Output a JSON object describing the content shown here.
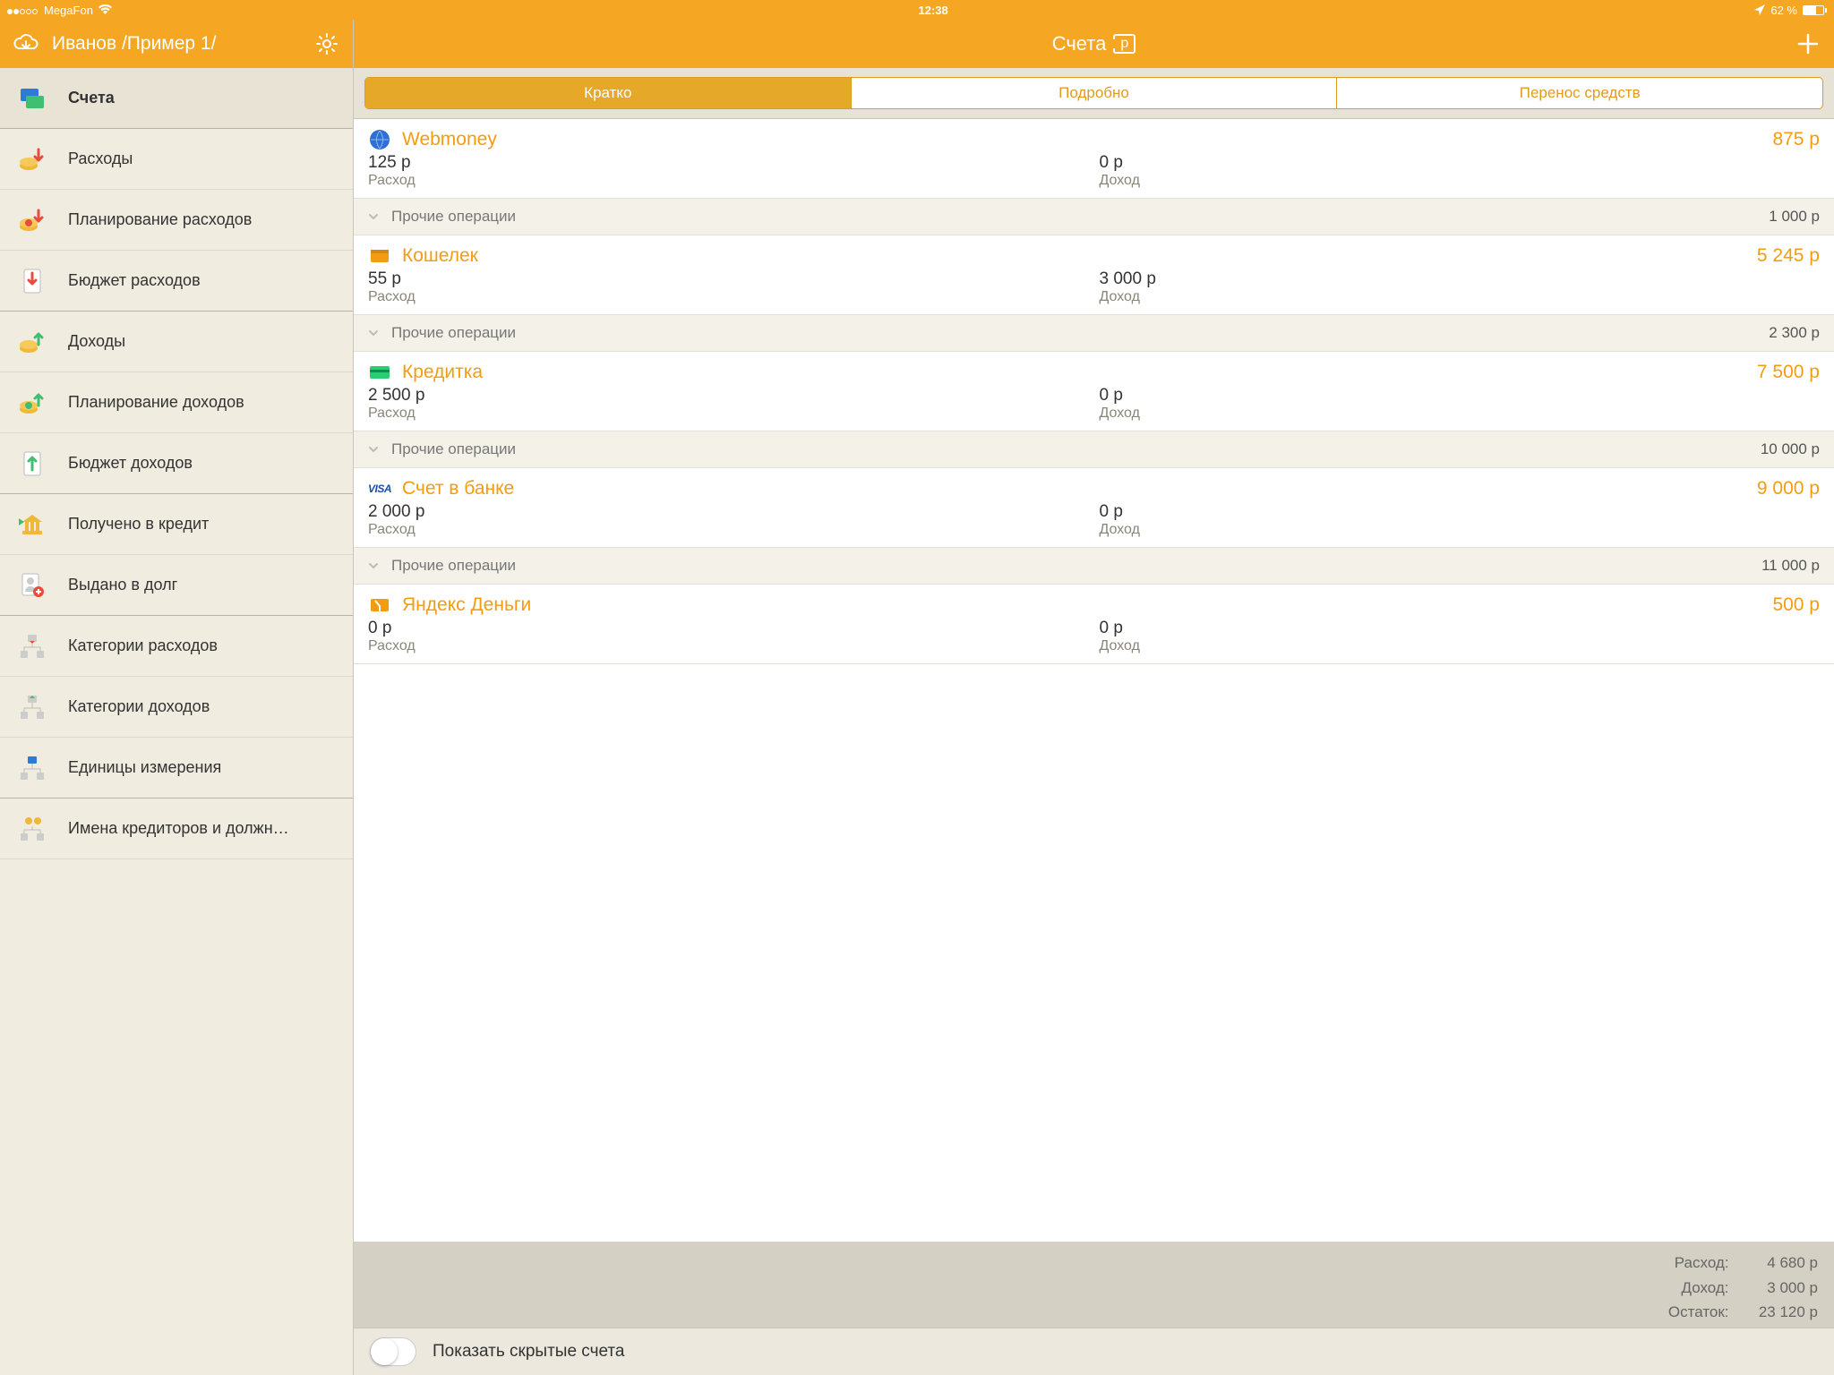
{
  "status": {
    "carrier": "MegaFon",
    "time": "12:38",
    "battery_pct": "62 %"
  },
  "sidebar": {
    "title": "Иванов /Пример 1/",
    "items": [
      {
        "label": "Счета",
        "icon": "wallet-cards-icon",
        "active": true
      },
      {
        "label": "Расходы",
        "icon": "coins-down-icon"
      },
      {
        "label": "Планирование расходов",
        "icon": "coins-down-plan-icon"
      },
      {
        "label": "Бюджет расходов",
        "icon": "doc-down-icon"
      },
      {
        "label": "Доходы",
        "icon": "coins-up-icon"
      },
      {
        "label": "Планирование доходов",
        "icon": "coins-up-plan-icon"
      },
      {
        "label": "Бюджет доходов",
        "icon": "doc-up-icon"
      },
      {
        "label": "Получено в кредит",
        "icon": "bank-in-icon"
      },
      {
        "label": "Выдано в долг",
        "icon": "person-debt-icon"
      },
      {
        "label": "Категории расходов",
        "icon": "tree-down-icon"
      },
      {
        "label": "Категории доходов",
        "icon": "tree-up-icon"
      },
      {
        "label": "Единицы измерения",
        "icon": "ruler-tree-icon"
      },
      {
        "label": "Имена кредиторов и должн…",
        "icon": "people-tree-icon"
      }
    ]
  },
  "main": {
    "title": "Счета",
    "segments": {
      "short": "Кратко",
      "detail": "Подробно",
      "transfer": "Перенос средств"
    },
    "other_ops_label": "Прочие операции",
    "expense_label": "Расход",
    "income_label": "Доход"
  },
  "accounts": [
    {
      "name": "Webmoney",
      "balance": "875 р",
      "expense": "125 р",
      "income": "0 р",
      "other": "1 000 р",
      "icon": "globe-blue-icon"
    },
    {
      "name": "Кошелек",
      "balance": "5 245 р",
      "expense": "55 р",
      "income": "3 000 р",
      "other": "2 300 р",
      "icon": "wallet-orange-icon"
    },
    {
      "name": "Кредитка",
      "balance": "7 500 р",
      "expense": "2 500 р",
      "income": "0 р",
      "other": "10 000 р",
      "icon": "card-green-icon"
    },
    {
      "name": "Счет в банке",
      "balance": "9 000 р",
      "expense": "2 000 р",
      "income": "0 р",
      "other": "11 000 р",
      "icon": "visa-icon"
    },
    {
      "name": "Яндекс Деньги",
      "balance": "500 р",
      "expense": "0 р",
      "income": "0 р",
      "other": null,
      "icon": "yandex-wallet-icon"
    }
  ],
  "summary": {
    "expense_label": "Расход:",
    "expense_value": "4 680 р",
    "income_label": "Доход:",
    "income_value": "3 000 р",
    "balance_label": "Остаток:",
    "balance_value": "23 120 р"
  },
  "toggle": {
    "label": "Показать скрытые счета"
  }
}
